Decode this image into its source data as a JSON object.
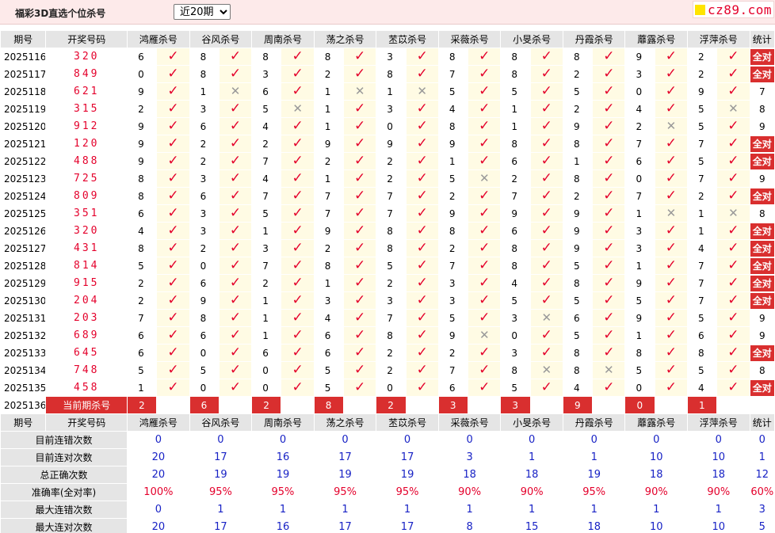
{
  "header": {
    "title": "福彩3D直选个位杀号",
    "range_select": {
      "value": "近20期",
      "options": [
        "近20期"
      ]
    },
    "site_badge": "cz89.com"
  },
  "table": {
    "col_issue": "期号",
    "col_draw": "开奖号码",
    "experts": [
      "鸿雁杀号",
      "谷风杀号",
      "周南杀号",
      "荡之杀号",
      "苤苡杀号",
      "采薇杀号",
      "小旻杀号",
      "丹霞杀号",
      "蘼露杀号",
      "浮萍杀号"
    ],
    "col_stat": "统计",
    "rows": [
      {
        "issue": "2025116",
        "draw": "320",
        "nums": [
          "6",
          "8",
          "8",
          "8",
          "3",
          "8",
          "8",
          "8",
          "9",
          "2"
        ],
        "hit": [
          1,
          1,
          1,
          1,
          1,
          1,
          1,
          1,
          1,
          1
        ],
        "stat": "全对",
        "all": true
      },
      {
        "issue": "2025117",
        "draw": "849",
        "nums": [
          "0",
          "8",
          "3",
          "2",
          "8",
          "7",
          "8",
          "2",
          "3",
          "2"
        ],
        "hit": [
          1,
          1,
          1,
          1,
          1,
          1,
          1,
          1,
          1,
          1
        ],
        "stat": "全对",
        "all": true
      },
      {
        "issue": "2025118",
        "draw": "621",
        "nums": [
          "9",
          "1",
          "6",
          "1",
          "1",
          "5",
          "5",
          "5",
          "0",
          "9"
        ],
        "hit": [
          1,
          0,
          1,
          0,
          0,
          1,
          1,
          1,
          1,
          1
        ],
        "stat": "7",
        "all": false
      },
      {
        "issue": "2025119",
        "draw": "315",
        "nums": [
          "2",
          "3",
          "5",
          "1",
          "3",
          "4",
          "1",
          "2",
          "4",
          "5"
        ],
        "hit": [
          1,
          1,
          0,
          1,
          1,
          1,
          1,
          1,
          1,
          0
        ],
        "stat": "8",
        "all": false
      },
      {
        "issue": "2025120",
        "draw": "912",
        "nums": [
          "9",
          "6",
          "4",
          "1",
          "0",
          "8",
          "1",
          "9",
          "2",
          "5"
        ],
        "hit": [
          1,
          1,
          1,
          1,
          1,
          1,
          1,
          1,
          0,
          1
        ],
        "stat": "9",
        "all": false
      },
      {
        "issue": "2025121",
        "draw": "120",
        "nums": [
          "9",
          "2",
          "2",
          "9",
          "9",
          "9",
          "8",
          "8",
          "7",
          "7"
        ],
        "hit": [
          1,
          1,
          1,
          1,
          1,
          1,
          1,
          1,
          1,
          1
        ],
        "stat": "全对",
        "all": true
      },
      {
        "issue": "2025122",
        "draw": "488",
        "nums": [
          "9",
          "2",
          "7",
          "2",
          "2",
          "1",
          "6",
          "1",
          "6",
          "5"
        ],
        "hit": [
          1,
          1,
          1,
          1,
          1,
          1,
          1,
          1,
          1,
          1
        ],
        "stat": "全对",
        "all": true
      },
      {
        "issue": "2025123",
        "draw": "725",
        "nums": [
          "8",
          "3",
          "4",
          "1",
          "2",
          "5",
          "2",
          "8",
          "0",
          "7"
        ],
        "hit": [
          1,
          1,
          1,
          1,
          1,
          0,
          1,
          1,
          1,
          1
        ],
        "stat": "9",
        "all": false
      },
      {
        "issue": "2025124",
        "draw": "809",
        "nums": [
          "8",
          "6",
          "7",
          "7",
          "7",
          "2",
          "7",
          "2",
          "7",
          "2"
        ],
        "hit": [
          1,
          1,
          1,
          1,
          1,
          1,
          1,
          1,
          1,
          1
        ],
        "stat": "全对",
        "all": true
      },
      {
        "issue": "2025125",
        "draw": "351",
        "nums": [
          "6",
          "3",
          "5",
          "7",
          "7",
          "9",
          "9",
          "9",
          "1",
          "1"
        ],
        "hit": [
          1,
          1,
          1,
          1,
          1,
          1,
          1,
          1,
          0,
          0
        ],
        "stat": "8",
        "all": false
      },
      {
        "issue": "2025126",
        "draw": "320",
        "nums": [
          "4",
          "3",
          "1",
          "9",
          "8",
          "8",
          "6",
          "9",
          "3",
          "1"
        ],
        "hit": [
          1,
          1,
          1,
          1,
          1,
          1,
          1,
          1,
          1,
          1
        ],
        "stat": "全对",
        "all": true
      },
      {
        "issue": "2025127",
        "draw": "431",
        "nums": [
          "8",
          "2",
          "3",
          "2",
          "8",
          "2",
          "8",
          "9",
          "3",
          "4"
        ],
        "hit": [
          1,
          1,
          1,
          1,
          1,
          1,
          1,
          1,
          1,
          1
        ],
        "stat": "全对",
        "all": true
      },
      {
        "issue": "2025128",
        "draw": "814",
        "nums": [
          "5",
          "0",
          "7",
          "8",
          "5",
          "7",
          "8",
          "5",
          "1",
          "7"
        ],
        "hit": [
          1,
          1,
          1,
          1,
          1,
          1,
          1,
          1,
          1,
          1
        ],
        "stat": "全对",
        "all": true
      },
      {
        "issue": "2025129",
        "draw": "915",
        "nums": [
          "2",
          "6",
          "2",
          "1",
          "2",
          "3",
          "4",
          "8",
          "9",
          "7"
        ],
        "hit": [
          1,
          1,
          1,
          1,
          1,
          1,
          1,
          1,
          1,
          1
        ],
        "stat": "全对",
        "all": true
      },
      {
        "issue": "2025130",
        "draw": "204",
        "nums": [
          "2",
          "9",
          "1",
          "3",
          "3",
          "3",
          "5",
          "5",
          "5",
          "7"
        ],
        "hit": [
          1,
          1,
          1,
          1,
          1,
          1,
          1,
          1,
          1,
          1
        ],
        "stat": "全对",
        "all": true
      },
      {
        "issue": "2025131",
        "draw": "203",
        "nums": [
          "7",
          "8",
          "1",
          "4",
          "7",
          "5",
          "3",
          "6",
          "9",
          "5"
        ],
        "hit": [
          1,
          1,
          1,
          1,
          1,
          1,
          0,
          1,
          1,
          1
        ],
        "stat": "9",
        "all": false
      },
      {
        "issue": "2025132",
        "draw": "689",
        "nums": [
          "6",
          "6",
          "1",
          "6",
          "8",
          "9",
          "0",
          "5",
          "1",
          "6"
        ],
        "hit": [
          1,
          1,
          1,
          1,
          1,
          0,
          1,
          1,
          1,
          1
        ],
        "stat": "9",
        "all": false
      },
      {
        "issue": "2025133",
        "draw": "645",
        "nums": [
          "6",
          "0",
          "6",
          "6",
          "2",
          "2",
          "3",
          "8",
          "8",
          "8"
        ],
        "hit": [
          1,
          1,
          1,
          1,
          1,
          1,
          1,
          1,
          1,
          1
        ],
        "stat": "全对",
        "all": true
      },
      {
        "issue": "2025134",
        "draw": "748",
        "nums": [
          "5",
          "5",
          "0",
          "5",
          "2",
          "7",
          "8",
          "8",
          "5",
          "5"
        ],
        "hit": [
          1,
          1,
          1,
          1,
          1,
          1,
          0,
          0,
          1,
          1
        ],
        "stat": "8",
        "all": false
      },
      {
        "issue": "2025135",
        "draw": "458",
        "nums": [
          "1",
          "0",
          "0",
          "5",
          "0",
          "6",
          "5",
          "4",
          "0",
          "4"
        ],
        "hit": [
          1,
          1,
          1,
          1,
          1,
          1,
          1,
          1,
          1,
          1
        ],
        "stat": "全对",
        "all": true
      }
    ],
    "current": {
      "issue": "2025136",
      "label": "当前期杀号",
      "kills": [
        "2",
        "6",
        "2",
        "8",
        "2",
        "3",
        "3",
        "9",
        "0",
        "1"
      ]
    }
  },
  "summary": {
    "header_issue": "期号",
    "header_draw": "开奖号码",
    "header_stat": "统计",
    "rows": [
      {
        "label": "目前连错次数",
        "values": [
          "0",
          "0",
          "0",
          "0",
          "0",
          "0",
          "0",
          "0",
          "0",
          "0"
        ],
        "stat": "0",
        "kind": "val"
      },
      {
        "label": "目前连对次数",
        "values": [
          "20",
          "17",
          "16",
          "17",
          "17",
          "3",
          "1",
          "1",
          "10",
          "10"
        ],
        "stat": "1",
        "kind": "val"
      },
      {
        "label": "总正确次数",
        "values": [
          "20",
          "19",
          "19",
          "19",
          "19",
          "18",
          "18",
          "19",
          "18",
          "18"
        ],
        "stat": "12",
        "kind": "val"
      },
      {
        "label": "准确率(全对率)",
        "values": [
          "100%",
          "95%",
          "95%",
          "95%",
          "95%",
          "90%",
          "90%",
          "95%",
          "90%",
          "90%"
        ],
        "stat": "60%",
        "kind": "rate"
      },
      {
        "label": "最大连错次数",
        "values": [
          "0",
          "1",
          "1",
          "1",
          "1",
          "1",
          "1",
          "1",
          "1",
          "1"
        ],
        "stat": "3",
        "kind": "val"
      },
      {
        "label": "最大连对次数",
        "values": [
          "20",
          "17",
          "16",
          "17",
          "17",
          "8",
          "15",
          "18",
          "10",
          "10"
        ],
        "stat": "5",
        "kind": "val"
      }
    ]
  },
  "colors": {
    "accent_red": "#e4002b",
    "badge_red": "#d92f2f",
    "blue_value": "#1822c5",
    "header_gray": "#e5e5e5",
    "mark_bg": "#fffbe4",
    "topbar_bg": "#fdeaea"
  },
  "icons": {
    "hit": "checkmark-icon",
    "miss": "cross-icon"
  }
}
